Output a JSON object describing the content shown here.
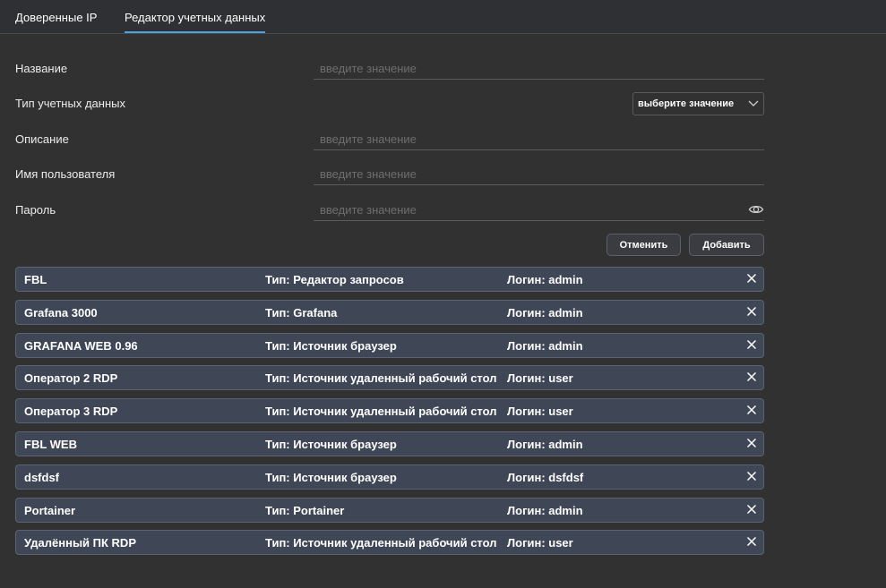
{
  "tabs": [
    {
      "label": "Доверенные IP",
      "active": false
    },
    {
      "label": "Редактор учетных данных",
      "active": true
    }
  ],
  "accent_color": "#4aa3df",
  "form": {
    "name": {
      "label": "Название",
      "placeholder": "введите значение",
      "value": ""
    },
    "credential_type": {
      "label": "Тип учетных данных",
      "selected": "выберите значение",
      "icon": "chevron-down-icon"
    },
    "description": {
      "label": "Описание",
      "placeholder": "введите значение",
      "value": ""
    },
    "username": {
      "label": "Имя пользователя",
      "placeholder": "введите значение",
      "value": ""
    },
    "password": {
      "label": "Пароль",
      "placeholder": "введите значение",
      "value": "",
      "icon": "eye-icon"
    }
  },
  "buttons": {
    "cancel": "Отменить",
    "add": "Добавить"
  },
  "credentials": [
    {
      "name": "FBL",
      "type": "Тип: Редактор запросов",
      "login": "Логин: admin"
    },
    {
      "name": "Grafana 3000",
      "type": "Тип: Grafana",
      "login": "Логин: admin"
    },
    {
      "name": "GRAFANA WEB 0.96",
      "type": "Тип: Источник браузер",
      "login": "Логин: admin"
    },
    {
      "name": "Оператор 2 RDP",
      "type": "Тип: Источник удаленный рабочий стол",
      "login": "Логин: user"
    },
    {
      "name": "Оператор 3 RDP",
      "type": "Тип: Источник удаленный рабочий стол",
      "login": "Логин: user"
    },
    {
      "name": "FBL WEB",
      "type": "Тип: Источник браузер",
      "login": "Логин: admin"
    },
    {
      "name": "dsfdsf",
      "type": "Тип: Источник браузер",
      "login": "Логин: dsfdsf"
    },
    {
      "name": "Portainer",
      "type": "Тип: Portainer",
      "login": "Логин: admin"
    },
    {
      "name": "Удалённый ПК RDP",
      "type": "Тип: Источник удаленный рабочий стол",
      "login": "Логин: user"
    }
  ]
}
